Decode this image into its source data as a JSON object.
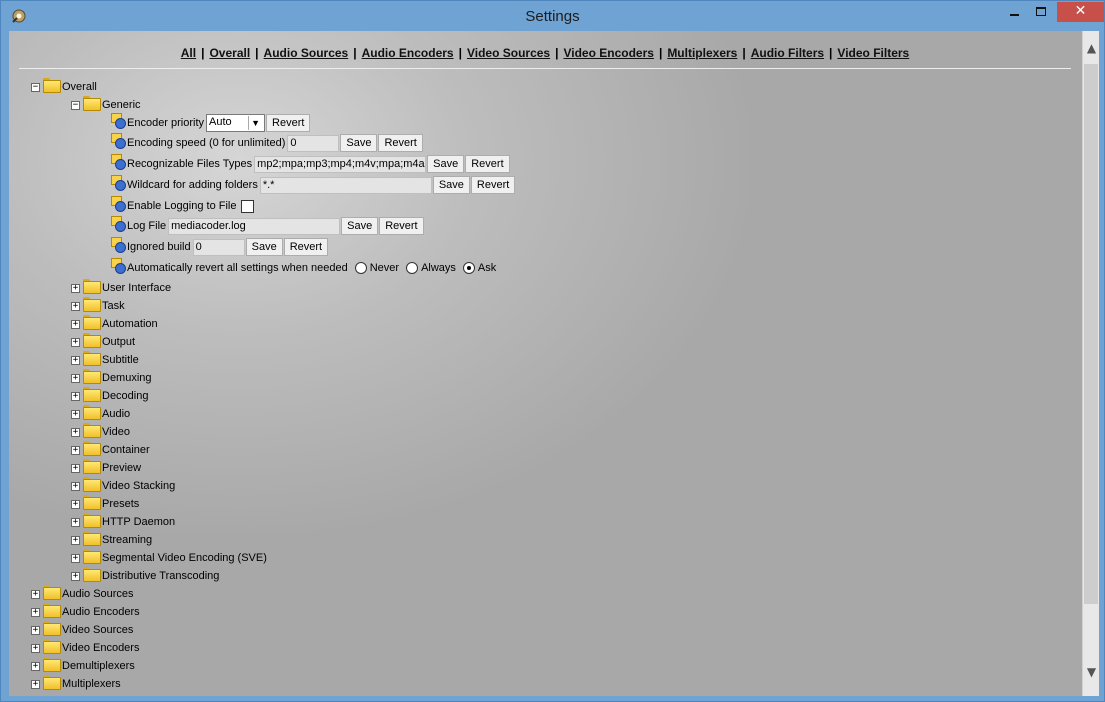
{
  "window": {
    "title": "Settings",
    "close_glyph": "✕"
  },
  "nav": {
    "links": [
      "All",
      "Overall",
      "Audio Sources",
      "Audio Encoders",
      "Video Sources",
      "Video Encoders",
      "Multiplexers",
      "Audio Filters",
      "Video Filters"
    ],
    "separator": "|"
  },
  "tree": {
    "overall": "Overall",
    "generic": "Generic",
    "settings": {
      "encoder_priority": {
        "label": "Encoder priority",
        "value": "Auto",
        "revert": "Revert"
      },
      "encoding_speed": {
        "label": "Encoding speed (0 for unlimited)",
        "value": "0",
        "save": "Save",
        "revert": "Revert"
      },
      "recognizable_types": {
        "label": "Recognizable Files Types",
        "value": "mp2;mpa;mp3;mp4;m4v;mpa;m4a;",
        "save": "Save",
        "revert": "Revert"
      },
      "wildcard": {
        "label": "Wildcard for adding folders",
        "value": "*.*",
        "save": "Save",
        "revert": "Revert"
      },
      "enable_logging": {
        "label": "Enable Logging to File",
        "checked": false
      },
      "log_file": {
        "label": "Log File",
        "value": "mediacoder.log",
        "save": "Save",
        "revert": "Revert"
      },
      "ignored_build": {
        "label": "Ignored build",
        "value": "0",
        "save": "Save",
        "revert": "Revert"
      },
      "auto_revert": {
        "label": "Automatically revert all settings when needed",
        "options": [
          "Never",
          "Always",
          "Ask"
        ],
        "selected": "Ask"
      }
    },
    "overall_children": [
      "User Interface",
      "Task",
      "Automation",
      "Output",
      "Subtitle",
      "Demuxing",
      "Decoding",
      "Audio",
      "Video",
      "Container",
      "Preview",
      "Video Stacking",
      "Presets",
      "HTTP Daemon",
      "Streaming",
      "Segmental Video Encoding (SVE)",
      "Distributive Transcoding"
    ],
    "top_level": [
      "Audio Sources",
      "Audio Encoders",
      "Video Sources",
      "Video Encoders",
      "Demultiplexers",
      "Multiplexers"
    ],
    "expand_glyph": "+",
    "collapse_glyph": "−"
  }
}
